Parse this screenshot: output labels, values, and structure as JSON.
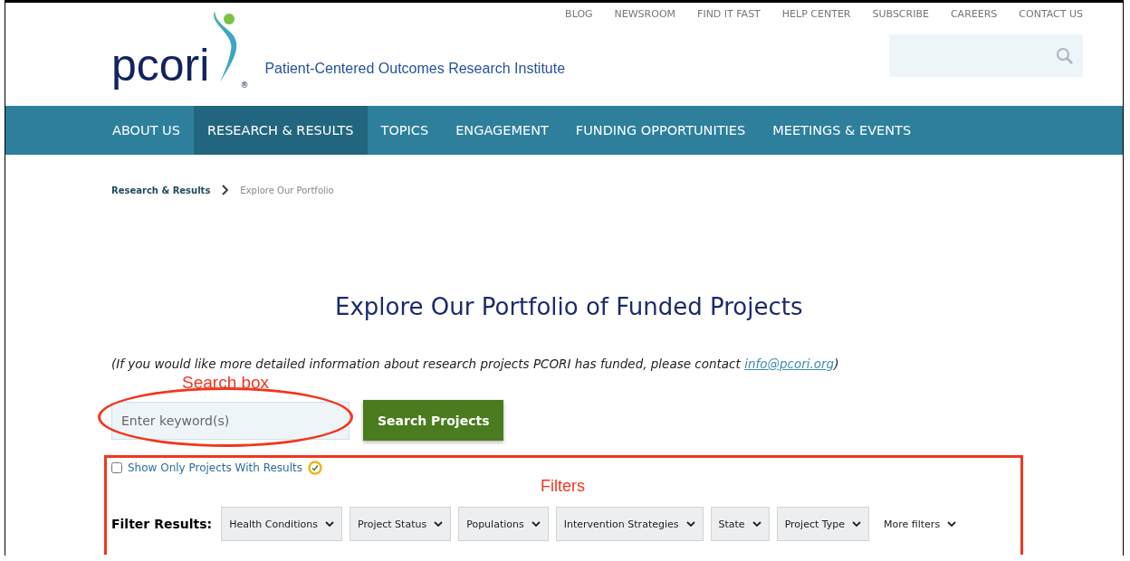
{
  "top_links": [
    {
      "label": "BLOG"
    },
    {
      "label": "NEWSROOM"
    },
    {
      "label": "FIND IT FAST"
    },
    {
      "label": "HELP CENTER"
    },
    {
      "label": "SUBSCRIBE"
    },
    {
      "label": "CAREERS"
    },
    {
      "label": "CONTACT US"
    }
  ],
  "logo": {
    "wordmark": "pcori",
    "registered": "®",
    "tagline": "Patient-Centered Outcomes Research Institute"
  },
  "nav": [
    {
      "label": "ABOUT US",
      "selected": false
    },
    {
      "label": "RESEARCH & RESULTS",
      "selected": true
    },
    {
      "label": "TOPICS",
      "selected": false
    },
    {
      "label": "ENGAGEMENT",
      "selected": false
    },
    {
      "label": "FUNDING OPPORTUNITIES",
      "selected": false
    },
    {
      "label": "MEETINGS & EVENTS",
      "selected": false
    }
  ],
  "breadcrumb": [
    {
      "label": "Research & Results"
    },
    {
      "label": "Explore Our Portfolio"
    }
  ],
  "heading": "Explore Our Portfolio of Funded Projects",
  "intro": {
    "before": "(If you would like more detailed information about research projects PCORI has funded, please contact ",
    "link": "info@pcori.org",
    "after": ")"
  },
  "annotations": {
    "search_label": "Search box",
    "filters_label": "Filters"
  },
  "search": {
    "placeholder": "Enter keyword(s)",
    "button": "Search Projects"
  },
  "results_only": {
    "label": "Show Only Projects With Results",
    "checked": false
  },
  "filter_label": "Filter Results:",
  "filters": [
    {
      "label": "Health Conditions"
    },
    {
      "label": "Project Status"
    },
    {
      "label": "Populations"
    },
    {
      "label": "Intervention Strategies"
    },
    {
      "label": "State"
    },
    {
      "label": "Project Type"
    }
  ],
  "more_filters": "More filters"
}
